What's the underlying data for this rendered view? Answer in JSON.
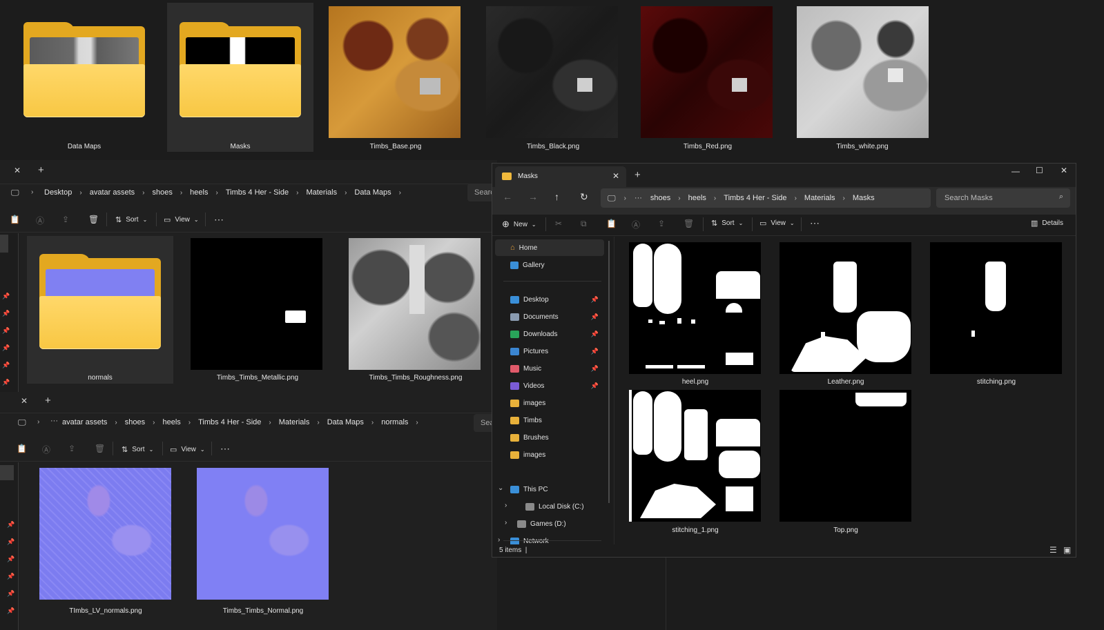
{
  "top_row": {
    "items": [
      {
        "name": "Data Maps"
      },
      {
        "name": "Masks"
      },
      {
        "name": "Timbs_Base.png"
      },
      {
        "name": "Timbs_Black.png"
      },
      {
        "name": "Timbs_Red.png"
      },
      {
        "name": "Timbs_white.png"
      }
    ]
  },
  "win_data_maps": {
    "tab_close": "✕",
    "tab_add": "+",
    "breadcrumb": [
      "Desktop",
      "avatar assets",
      "shoes",
      "heels",
      "Timbs 4 Her - Side",
      "Materials",
      "Data Maps"
    ],
    "search_placeholder": "Searc",
    "toolbar": {
      "sort_label": "Sort",
      "view_label": "View"
    },
    "items": [
      {
        "name": "normals"
      },
      {
        "name": "Timbs_Timbs_Metallic.png"
      },
      {
        "name": "Timbs_Timbs_Roughness.png"
      }
    ]
  },
  "win_normals": {
    "tab_close": "✕",
    "tab_add": "+",
    "breadcrumb": [
      "avatar assets",
      "shoes",
      "heels",
      "Timbs 4 Her - Side",
      "Materials",
      "Data Maps",
      "normals"
    ],
    "search_placeholder": "Sea",
    "toolbar": {
      "sort_label": "Sort",
      "view_label": "View"
    },
    "items": [
      {
        "name": "TImbs_LV_normals.png"
      },
      {
        "name": "Timbs_Timbs_Normal.png"
      }
    ]
  },
  "win_masks": {
    "tab_title": "Masks",
    "tab_add": "+",
    "breadcrumb": [
      "shoes",
      "heels",
      "Timbs 4 Her - Side",
      "Materials",
      "Masks"
    ],
    "search_placeholder": "Search Masks",
    "toolbar": {
      "new_label": "New",
      "sort_label": "Sort",
      "view_label": "View",
      "details_label": "Details"
    },
    "sidebar": {
      "top": [
        {
          "label": "Home",
          "icon": "home-icon"
        },
        {
          "label": "Gallery",
          "icon": "gallery-icon"
        }
      ],
      "pinned": [
        {
          "label": "Desktop",
          "icon": "desktop-folder-icon",
          "color": "#3a8fd8"
        },
        {
          "label": "Documents",
          "icon": "documents-folder-icon",
          "color": "#8a9bb0"
        },
        {
          "label": "Downloads",
          "icon": "downloads-icon",
          "color": "#29a35a"
        },
        {
          "label": "Pictures",
          "icon": "pictures-folder-icon",
          "color": "#3b86d1"
        },
        {
          "label": "Music",
          "icon": "music-icon",
          "color": "#e05a6a"
        },
        {
          "label": "Videos",
          "icon": "videos-icon",
          "color": "#7a5bd6"
        },
        {
          "label": "images",
          "icon": "folder-icon",
          "color": "#e8b13a"
        },
        {
          "label": "Timbs",
          "icon": "folder-icon",
          "color": "#e8b13a"
        },
        {
          "label": "Brushes",
          "icon": "folder-icon",
          "color": "#e8b13a"
        },
        {
          "label": "images",
          "icon": "folder-icon",
          "color": "#e8b13a"
        }
      ],
      "tree": [
        {
          "label": "This PC",
          "icon": "this-pc-icon"
        },
        {
          "label": "Local Disk (C:)",
          "icon": "drive-icon"
        },
        {
          "label": "Games (D:)",
          "icon": "drive-icon"
        },
        {
          "label": "Network",
          "icon": "network-icon"
        }
      ]
    },
    "items": [
      {
        "name": "heel.png"
      },
      {
        "name": "Leather.png"
      },
      {
        "name": "stitching.png"
      },
      {
        "name": "stitching_1.png"
      },
      {
        "name": "Top.png"
      }
    ],
    "status": "5 items  |"
  },
  "colors": {
    "accent_folder": "#f8c743",
    "normal_map": "#8080ff",
    "bg": "#1c1c1c"
  }
}
